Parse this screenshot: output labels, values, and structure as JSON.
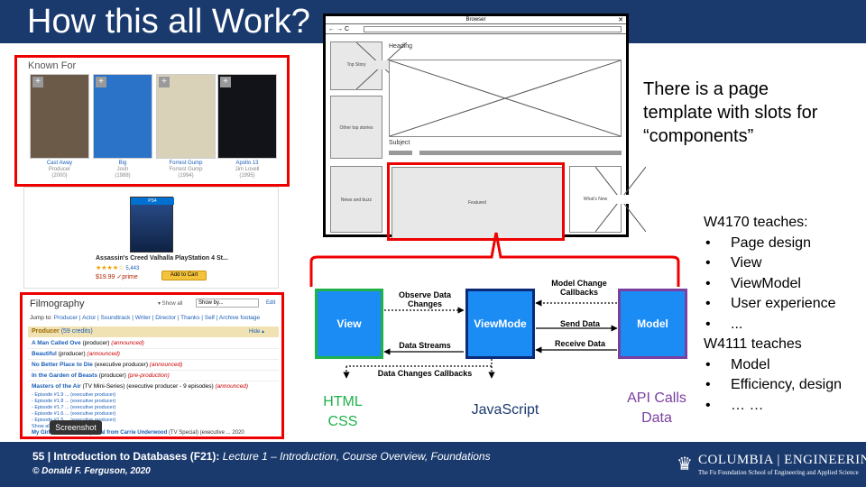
{
  "slide": {
    "title": "How this all Work?",
    "description": "There is a page template with slots for “components”"
  },
  "known_for": {
    "label": "Known For",
    "posters": [
      {
        "title": "Cast Away",
        "role": "Producer",
        "year": "(2000)",
        "color": "#6b5a48"
      },
      {
        "title": "Big",
        "role": "Josh",
        "year": "(1988)",
        "color": "#2a73c9"
      },
      {
        "title": "Forrest Gump",
        "role": "Forrest Gump",
        "year": "(1994)",
        "color": "#d9d2b8"
      },
      {
        "title": "Apollo 13",
        "role": "Jim Lovell",
        "year": "(1995)",
        "color": "#111318"
      }
    ]
  },
  "ad": {
    "badge": "PS4",
    "title": "Assassin's Creed Valhalla PlayStation 4 St...",
    "stars": "★★★★☆",
    "rating_count": "5,443",
    "price": "$19.99 ✓prime",
    "button": "Add to Cart"
  },
  "filmography": {
    "title": "Filmography",
    "show_all": "▾ Show all",
    "select": "Show by...",
    "edit": "Edit",
    "jump_label": "Jump to:",
    "jump_links": "Producer | Actor | Soundtrack | Writer | Director | Thanks | Self | Archive footage",
    "producer_header": "Producer",
    "producer_count": "(59 credits)",
    "hide": "Hide ▴",
    "rows": [
      {
        "title": "A Man Called Ove",
        "role": "(producer)",
        "note": "(announced)"
      },
      {
        "title": "Beautiful",
        "role": "(producer)",
        "note": "(announced)"
      },
      {
        "title": "No Better Place to Die",
        "role": "(executive producer)",
        "note": "(announced)"
      },
      {
        "title": "In the Garden of Beasts",
        "role": "(producer)",
        "note": "(pre-production)"
      },
      {
        "title": "Masters of the Air",
        "role": "(TV Mini-Series) (executive producer - 9 episodes)",
        "note": "(announced)"
      }
    ],
    "episodes": [
      "- Episode #1.9 ... (executive producer)",
      "- Episode #1.8 ... (executive producer)",
      "- Episode #1.7 ... (executive producer)",
      "- Episode #1.6 ... (executive producer)",
      "- Episode #1.5 ... (executive producer)",
      "Show all 9 episodes"
    ],
    "last_row_title": "My Girl: A Christmas Special from Carrie Underwood",
    "last_row_rest": "(TV Special) (executive ...",
    "last_row_year": "2020",
    "tooltip": "Screenshot"
  },
  "wireframe": {
    "window_title": "Browser",
    "close": "✕",
    "nav_buttons": "←→C",
    "heading": "Heading",
    "subject": "Subject",
    "top_story": "Top Story",
    "other_top_stories": "Other top stories",
    "news_and_buzz": "News and buzz",
    "featured": "Featured",
    "whats_new": "What's New"
  },
  "teaches": {
    "w4170_header": "W4170 teaches:",
    "w4170_items": [
      "Page design",
      "View",
      "ViewModel",
      "User experience",
      "..."
    ],
    "w4111_header": "W4111 teaches",
    "w4111_items": [
      "Model",
      "Efficiency, design",
      "… …"
    ]
  },
  "diagram": {
    "nodes": {
      "view": {
        "label": "View",
        "border": "#1fb24a"
      },
      "viewmodel": {
        "label": "ViewMode",
        "border": "#0b2a78"
      },
      "model": {
        "label": "Model",
        "border": "#7a3fa0"
      }
    },
    "node_fill": "#1c8cf5",
    "edges": {
      "observe": "Observe Data\nChanges",
      "data_streams": "Data Streams",
      "data_changes_callbacks": "Data Changes Callbacks",
      "model_change_callbacks": "Model Change\nCallbacks",
      "send_data": "Send Data",
      "receive_data": "Receive Data"
    },
    "languages": {
      "view": "HTML\nCSS",
      "viewmodel": "JavaScript",
      "model": "API Calls\nData"
    },
    "language_colors": {
      "view": "#1fb24a",
      "viewmodel": "#1a3a6e",
      "model": "#7a3fa0"
    }
  },
  "footer": {
    "number": "55",
    "course": "Introduction to Databases (F21):",
    "lecture": "Lecture 1 – Introduction, Course Overview, Foundations",
    "author": "© Donald F. Ferguson, 2020",
    "logo_main": "COLUMBIA | ENGINEERING",
    "logo_sub": "The Fu Foundation School of Engineering and Applied Science"
  }
}
